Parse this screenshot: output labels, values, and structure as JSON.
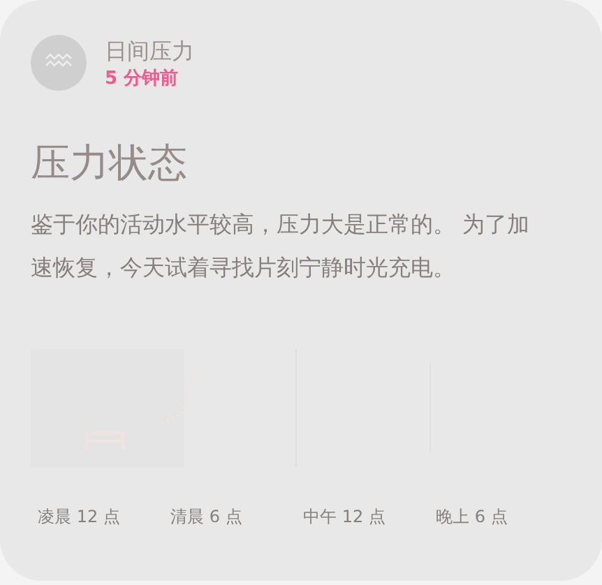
{
  "header": {
    "title": "日间压力",
    "time": "5 分钟前"
  },
  "status": {
    "heading": "压力状态",
    "message": "鉴于你的活动水平较高，压力大是正常的。 为了加速恢复，今天试着寻找片刻宁静时光充电。"
  },
  "chart": {
    "x_labels": [
      "凌晨 12 点",
      "清晨 6 点",
      "中午 12 点",
      "晚上 6 点"
    ]
  }
}
